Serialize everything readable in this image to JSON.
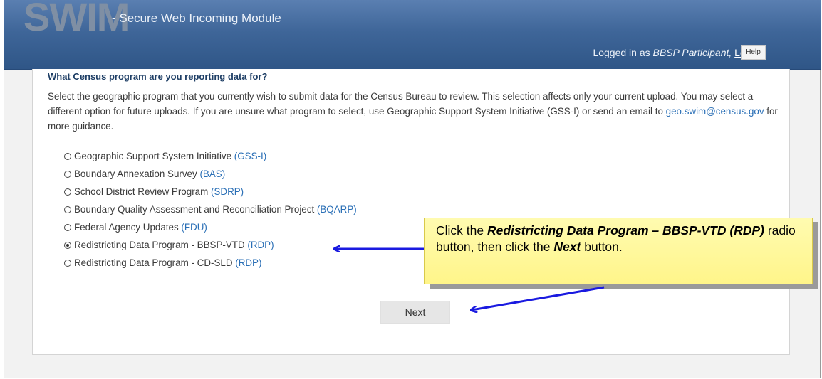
{
  "header": {
    "logo": "SWIM",
    "subtitle": "- Secure Web Incoming Module",
    "login_prefix": "Logged in as",
    "user_name": "BBSP Participant,",
    "logout_label": "Logout",
    "help_label": "Help"
  },
  "main": {
    "question": "What Census program are you reporting data for?",
    "description_1": "Select the geographic program that you currently wish to submit data for the Census Bureau to review. This selection affects only your current upload. You may select a different option for future uploads. If you are unsure what program to select, use Geographic Support System Initiative (GSS-I) or send an email to",
    "email": "geo.swim@census.gov",
    "description_2": "for more guidance.",
    "options": [
      {
        "label": "Geographic Support System Initiative",
        "abbr": "(GSS-I)",
        "selected": false
      },
      {
        "label": "Boundary Annexation Survey",
        "abbr": "(BAS)",
        "selected": false
      },
      {
        "label": "School District Review Program",
        "abbr": "(SDRP)",
        "selected": false
      },
      {
        "label": "Boundary Quality Assessment and Reconciliation Project",
        "abbr": "(BQARP)",
        "selected": false
      },
      {
        "label": "Federal Agency Updates",
        "abbr": "(FDU)",
        "selected": false
      },
      {
        "label": "Redistricting Data Program - BBSP-VTD",
        "abbr": "(RDP)",
        "selected": true
      },
      {
        "label": "Redistricting Data Program - CD-SLD",
        "abbr": "(RDP)",
        "selected": false
      }
    ],
    "next_label": "Next"
  },
  "callout": {
    "text_1": "Click the",
    "bold_1": "Redistricting Data Program – BBSP-VTD (RDP)",
    "text_2": "radio button, then click the",
    "bold_2": "Next",
    "text_3": "button."
  },
  "colors": {
    "header_blue": "#3f6699",
    "link_blue": "#2a6fb6",
    "callout_yellow": "#fff58a",
    "arrow_blue": "#1a1ae0"
  }
}
